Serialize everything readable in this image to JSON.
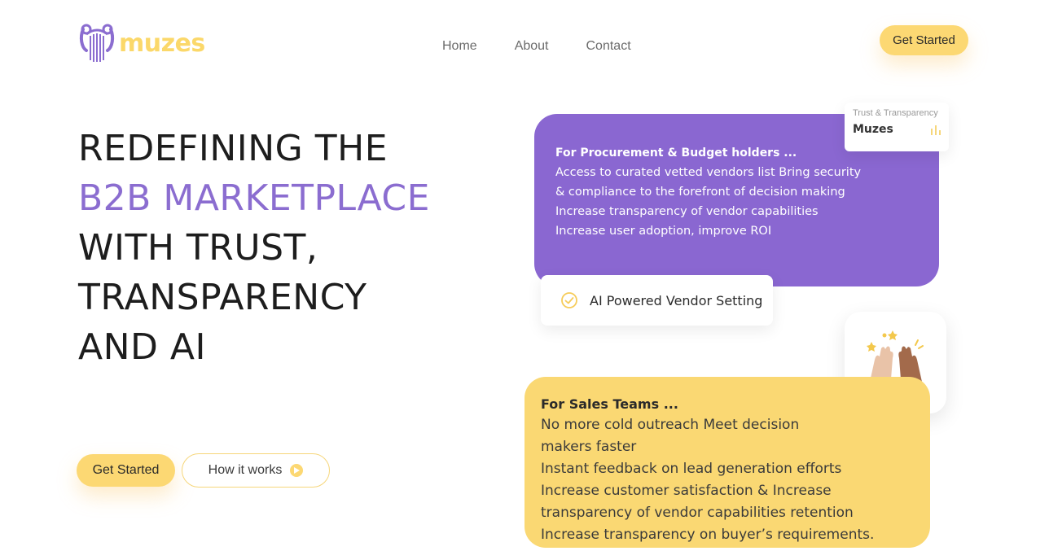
{
  "brand": {
    "name": "muzes",
    "accent": "#8b6dd0",
    "yellow": "#fcd873"
  },
  "nav": {
    "items": [
      "Home",
      "About",
      "Contact"
    ]
  },
  "header": {
    "cta_label": "Get Started"
  },
  "hero": {
    "line1": "REDEFINING THE",
    "line2": "B2B MARKETPLACE",
    "line3": "WITH TRUST,",
    "line4": "TRANSPARENCY",
    "line5": "AND AI",
    "cta_label": "Get Started",
    "secondary_label": "How it works"
  },
  "procurement_card": {
    "title": "For Procurement & Budget holders ...",
    "lines": [
      "Access to curated vetted vendors list Bring security",
      "& compliance to the forefront of decision making",
      "Increase transparency of vendor capabilities",
      "Increase user adoption, improve ROI"
    ]
  },
  "trust_badge": {
    "subtitle": "Trust & Transparency",
    "title": "Muzes"
  },
  "ai_pill": {
    "label": "AI Powered Vendor Setting"
  },
  "sales_card": {
    "title": "For Sales Teams ...",
    "lines": [
      "No more cold outreach Meet decision",
      "makers faster",
      "Instant feedback on lead generation efforts",
      "Increase customer satisfaction & Increase",
      "transparency of vendor capabilities retention",
      "Increase transparency on buyer’s requirements."
    ]
  },
  "icons": [
    "logo-harp-icon",
    "play-icon",
    "check-circle-icon",
    "bar-chart-icon",
    "high-five-icon"
  ]
}
